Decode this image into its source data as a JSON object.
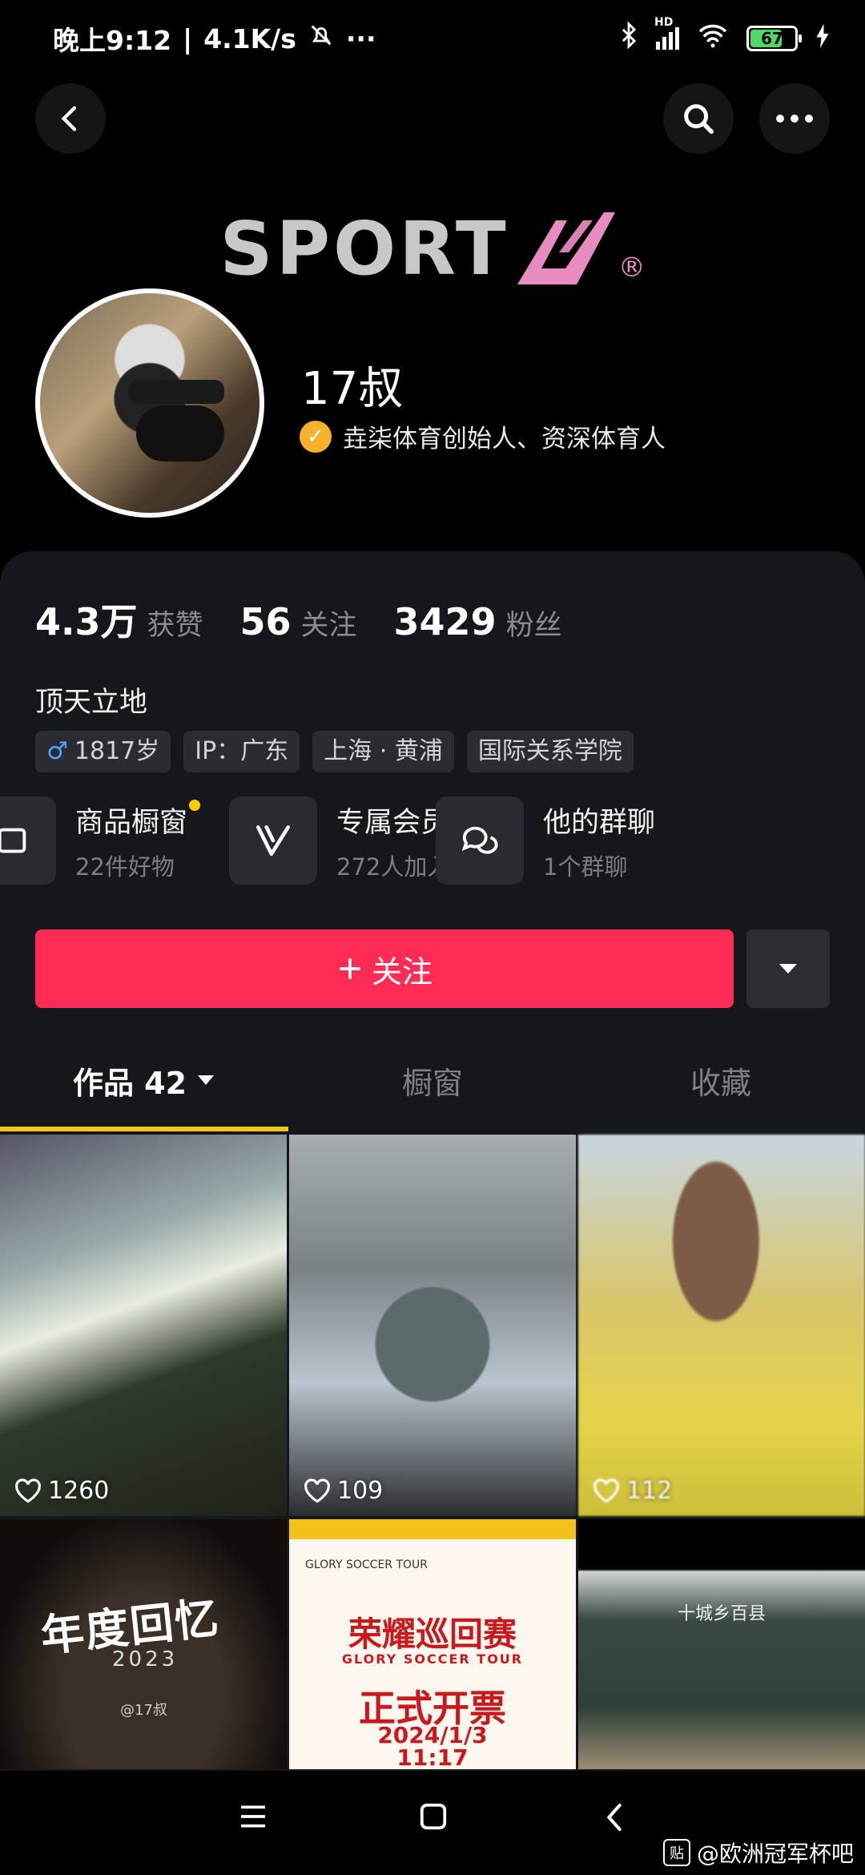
{
  "status_bar": {
    "time": "晚上9:12",
    "speed": "4.1K/s",
    "dots": "···",
    "network": "HD",
    "battery": "67",
    "battery_level": 67
  },
  "header": {
    "back_icon": "back-arrow-icon",
    "search_icon": "search-icon",
    "more_icon": "more-icon"
  },
  "banner": {
    "brand": "SPORT",
    "brand_mark": "®"
  },
  "profile": {
    "name": "17叔",
    "verified_text": "垚柒体育创始人、资深体育人"
  },
  "stats": [
    {
      "num": "4.3万",
      "label": "获赞"
    },
    {
      "num": "56",
      "label": "关注"
    },
    {
      "num": "3429",
      "label": "粉丝"
    }
  ],
  "bio": "顶天立地",
  "tags": {
    "gender_symbol": "♂",
    "age": "1817岁",
    "ip": "IP：广东",
    "location": "上海 · 黄浦",
    "school": "国际关系学院"
  },
  "features": [
    {
      "title": "商品橱窗",
      "sub": "22件好物"
    },
    {
      "title": "专属会员",
      "sub": "272人加入"
    },
    {
      "title": "他的群聊",
      "sub": "1个群聊"
    }
  ],
  "follow_label": "关注",
  "tabs": {
    "works": "作品 42",
    "shop": "橱窗",
    "favorites": "收藏"
  },
  "videos": [
    {
      "likes": "1260"
    },
    {
      "likes": "109"
    },
    {
      "likes": "112"
    }
  ],
  "thumb_texts": {
    "memory_title": "年度回忆",
    "memory_year": "2023",
    "memory_handle": "@17叔",
    "poster_head_1": "GLORY SOCCER TOUR",
    "poster_title": "荣耀巡回赛",
    "poster_sub": "GLORY SOCCER TOUR",
    "poster_title2": "正式开票",
    "poster_date": "2024/1/3",
    "poster_time": "11:17",
    "board_text": "十城乡百县"
  },
  "watermark": {
    "icon": "贴",
    "text": "@欧洲冠军杯吧"
  },
  "colors": {
    "follow": "#fe2c55",
    "tab_indicator": "#f5c61a",
    "verified": "#f5b22a",
    "male": "#4aa3ff"
  }
}
